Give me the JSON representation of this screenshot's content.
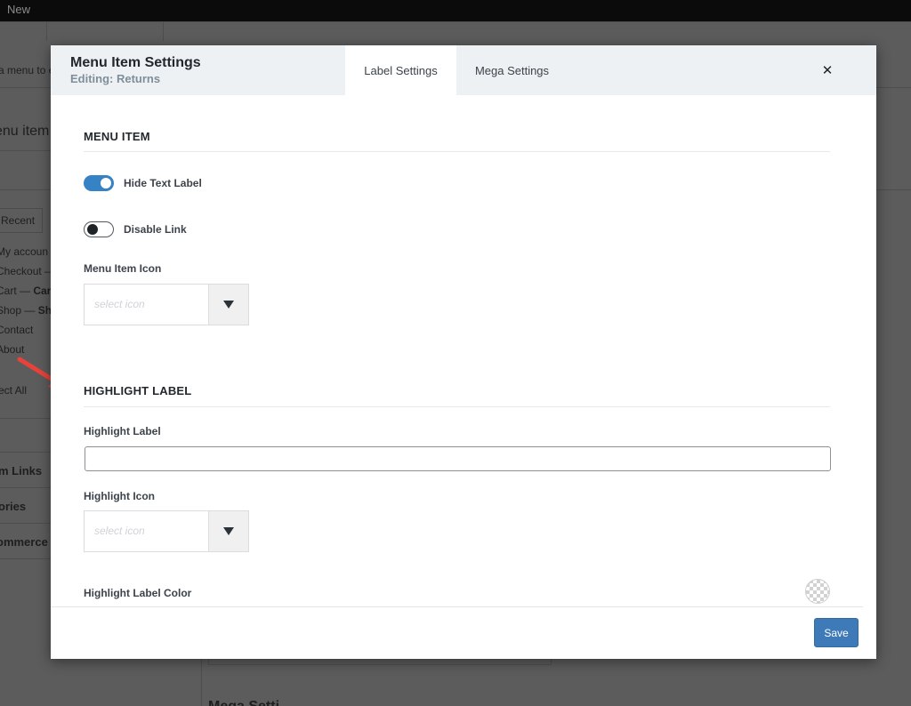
{
  "admin_bar": {
    "new_label": "New"
  },
  "background": {
    "menu_intro_fragment": "a menu to e",
    "heading_fragment": "enu item",
    "tab_recent": "Recent",
    "pages": [
      {
        "name": "My accoun",
        "suffix": ""
      },
      {
        "name": "Checkout –",
        "suffix": ""
      },
      {
        "name": "Cart — ",
        "suffix": "Car"
      },
      {
        "name": "Shop — ",
        "suffix": "Sh"
      },
      {
        "name": "Contact",
        "suffix": ""
      },
      {
        "name": "About",
        "suffix": ""
      }
    ],
    "select_all_fragment": "ect All",
    "sections": [
      "m Links",
      "ories",
      "ommerce"
    ],
    "bottom_heading_fragment": "Mega Setti"
  },
  "modal": {
    "title": "Menu Item Settings",
    "subtitle": "Editing: Returns",
    "tabs": [
      {
        "label": "Label Settings",
        "active": true
      },
      {
        "label": "Mega Settings",
        "active": false
      }
    ],
    "close_symbol": "✕",
    "menu_item_section": {
      "heading": "MENU ITEM",
      "hide_text_label": {
        "label": "Hide Text Label",
        "on": true
      },
      "disable_link": {
        "label": "Disable Link",
        "on": false
      },
      "icon_field": {
        "label": "Menu Item Icon",
        "placeholder": "select icon"
      }
    },
    "highlight_section": {
      "heading": "HIGHLIGHT LABEL",
      "label_field": {
        "label": "Highlight Label",
        "value": ""
      },
      "icon_field": {
        "label": "Highlight Icon",
        "placeholder": "select icon"
      },
      "color_field": {
        "label": "Highlight Label Color",
        "value": "transparent"
      }
    },
    "save_label": "Save"
  },
  "colors": {
    "accent": "#3582c4",
    "save_button": "#3e7ab8",
    "header_bg": "#edf1f4",
    "annotation_arrow": "#e8423a"
  }
}
